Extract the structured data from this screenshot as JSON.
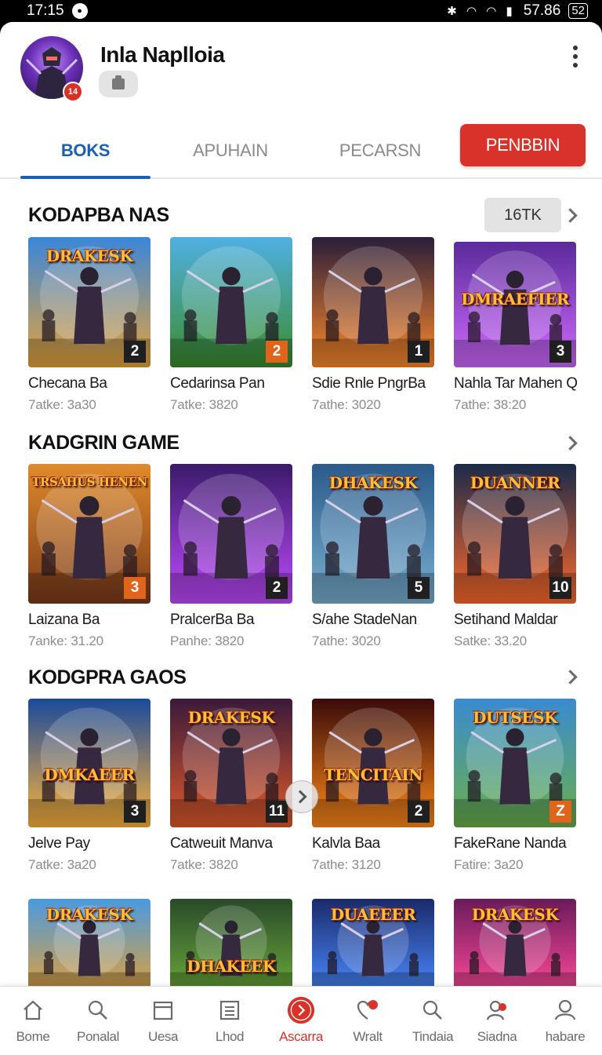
{
  "status_bar": {
    "time": "17:15",
    "notification_badge": "",
    "battery": "57.86",
    "battery_box": "52"
  },
  "profile": {
    "name": "Inla Naplloia",
    "avatar_badge": "14"
  },
  "tabs": [
    {
      "label": "BOKS",
      "active": true
    },
    {
      "label": "APUHAIN",
      "active": false
    },
    {
      "label": "PECARSN",
      "active": false
    }
  ],
  "primary_tab": {
    "label": "PENBBIN"
  },
  "sections": [
    {
      "title": "KODAPBA NAS",
      "count": "16TK",
      "items": [
        {
          "title": "Checana Ba",
          "sub": "7atke: 3a30",
          "rank": "2",
          "logo": "DRAKESK",
          "palette": [
            "#3a86d9",
            "#e6a33a"
          ]
        },
        {
          "title": "Cedarinsa Pan",
          "sub": "7atke: 3820",
          "rank": "2",
          "rank_style": "orange",
          "logo": "",
          "palette": [
            "#4fb0e3",
            "#3a8c2a"
          ]
        },
        {
          "title": "Sdie Rnle PngrBa",
          "sub": "7athe: 3020",
          "rank": "1",
          "logo": "",
          "palette": [
            "#2a1d3a",
            "#ff8a2a"
          ]
        },
        {
          "title": "Nahla Tar Mahen Q",
          "sub": "7athe: 38:20",
          "rank": "3",
          "logo": "DMRAEFIER",
          "palette": [
            "#5a2a9a",
            "#d06aff"
          ]
        }
      ]
    },
    {
      "title": "KADGRIN GAME",
      "items": [
        {
          "title": "Laizana Ba",
          "sub": "7anke: 31.20",
          "rank": "3",
          "rank_style": "orange",
          "logo": "TRSAHUS HENEN",
          "palette": [
            "#e08a2a",
            "#7a3a1a"
          ]
        },
        {
          "title": "PralcerBa Ba",
          "sub": "Panhe: 3820",
          "rank": "2",
          "logo": "",
          "palette": [
            "#3a1a6a",
            "#c04aff"
          ]
        },
        {
          "title": "S/ahe StadeNan",
          "sub": "7athe: 3020",
          "rank": "5",
          "logo": "DHAKESK",
          "palette": [
            "#2a5a8a",
            "#7ab0d0"
          ]
        },
        {
          "title": "Setihand Maldar",
          "sub": "Satke: 33.20",
          "rank": "10",
          "logo": "DUANNER",
          "palette": [
            "#1a2a4a",
            "#ff6a2a"
          ]
        }
      ]
    },
    {
      "title": "KODGPRA GAOS",
      "items": [
        {
          "title": "Jelve Pay",
          "sub": "7atke: 3a20",
          "rank": "3",
          "logo": "DMKAEER",
          "palette": [
            "#1a4a9a",
            "#ffb43a"
          ]
        },
        {
          "title": "Catweuit Manva",
          "sub": "7atke: 3820",
          "rank": "11",
          "logo": "DRAKESK",
          "palette": [
            "#3a1a3a",
            "#e05a2a"
          ]
        },
        {
          "title": "Kalvla Baa",
          "sub": "7athe: 3120",
          "rank": "2",
          "logo": "TENCITAIN",
          "palette": [
            "#3a0a0a",
            "#ff8a1a"
          ]
        },
        {
          "title": "FakeRane Nanda",
          "sub": "Fatire: 3a20",
          "rank": "Z",
          "rank_style": "orange",
          "logo": "DUTSESK",
          "palette": [
            "#3a8ad0",
            "#6ab04a"
          ]
        }
      ]
    },
    {
      "title": "",
      "items": [
        {
          "logo": "DRAKESK",
          "palette": [
            "#4a9ae0",
            "#e0a03a"
          ]
        },
        {
          "logo": "DHAKEEK",
          "palette": [
            "#2a4a2a",
            "#6aaa3a"
          ]
        },
        {
          "logo": "DUAEEER",
          "palette": [
            "#1a2a6a",
            "#4a8aff"
          ]
        },
        {
          "logo": "DRAKESK",
          "palette": [
            "#6a1a5a",
            "#ff4a9a"
          ]
        }
      ]
    }
  ],
  "bottom_nav": [
    {
      "label": "Bome",
      "icon": "home-icon"
    },
    {
      "label": "Ponalal",
      "icon": "search-icon"
    },
    {
      "label": "Uesa",
      "icon": "calendar-icon"
    },
    {
      "label": "Lhod",
      "icon": "list-icon"
    },
    {
      "label": "Ascarra",
      "icon": "play-icon",
      "active": true
    },
    {
      "label": "Wralt",
      "icon": "heart-icon"
    },
    {
      "label": "Tindaia",
      "icon": "search-icon"
    },
    {
      "label": "Siadna",
      "icon": "user-badge-icon"
    },
    {
      "label": "habare",
      "icon": "user-icon"
    }
  ],
  "colors": {
    "accent_blue": "#1a5fb4",
    "accent_red": "#d8322a"
  }
}
